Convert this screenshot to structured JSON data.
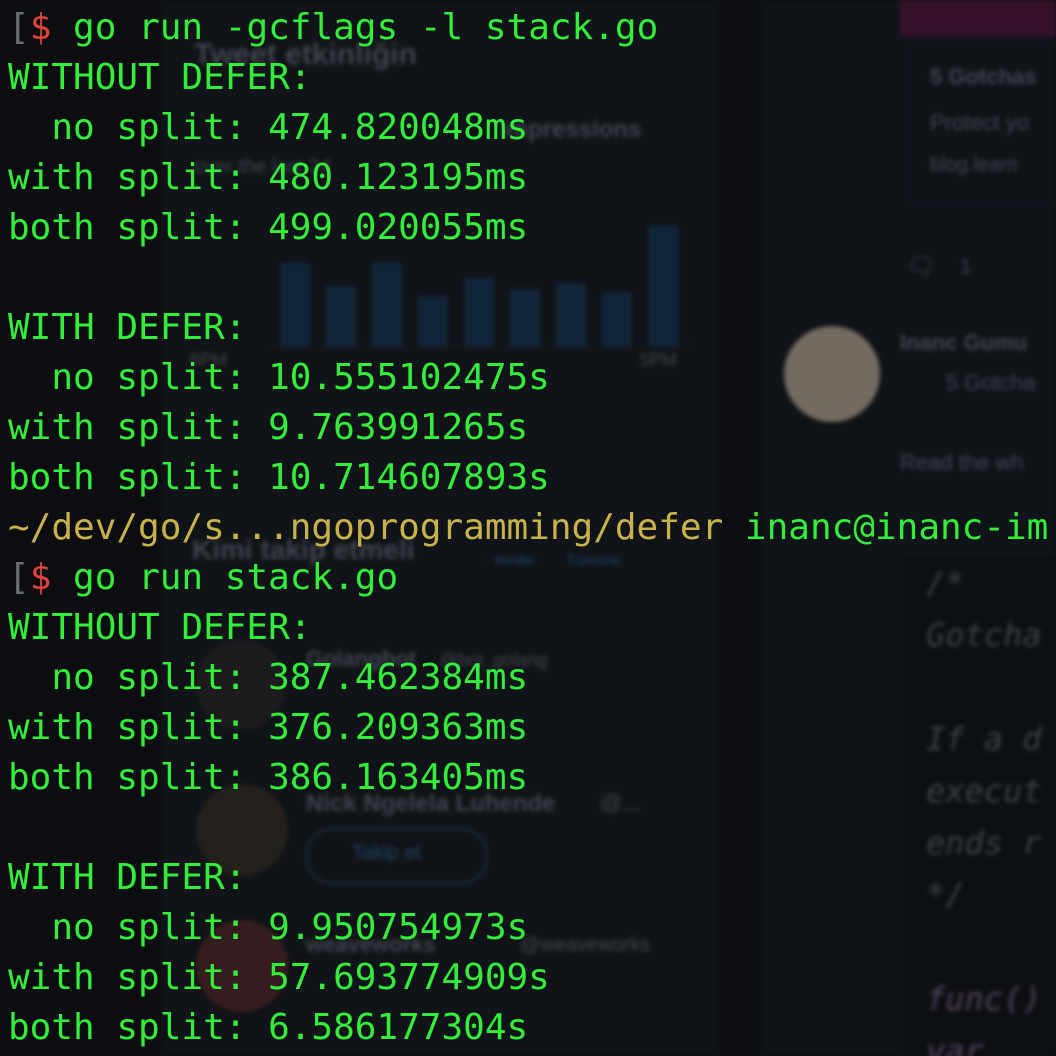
{
  "background": {
    "tweet_heading": "Tweet etkinliğin",
    "impressions_label": "Impressions",
    "over_label": "over the last 24",
    "chart_start_label": "6PM",
    "chart_end_label": "5PM",
    "chart_bars": [
      0.55,
      0.4,
      0.55,
      0.33,
      0.45,
      0.38,
      0.42,
      0.35,
      0.8
    ],
    "who_to_follow": "Kimi takip etmeli",
    "refresh": "· Yenile ·",
    "all": "Tümünü",
    "account1_name": "Golangbot",
    "account1_handle": "@bot_golang",
    "account2_name": "Nick Ngelela Luhende",
    "account2_handle": "@...",
    "follow_button": "Takip et",
    "account3_name": "weaveworks",
    "account3_handle": "@weaveworks",
    "card_title": "5 Gotchas",
    "card_line": "Protect yo",
    "card_url": "blog.learn",
    "reply_count": "1",
    "author_name": "Inanc Gumu",
    "author_sub": "5 Gotcha",
    "read_the": "Read the wh",
    "code_lines": [
      "/*",
      "Gotcha",
      "",
      "If a d",
      "execut",
      "ends r",
      "*/",
      "",
      "func()",
      "var"
    ],
    "colors": {
      "pink_accent": "#5a1740",
      "chart_blue": "#173a5e"
    }
  },
  "terminal": {
    "colors": {
      "output_green": "#33ee3b",
      "dollar_red": "#e0443e",
      "path_yellow": "#c8b24b"
    },
    "prompt_bracket": "[",
    "prompt_symbol": "$",
    "command1": " go run -gcflags -l stack.go",
    "run1": {
      "without_defer_header": "WITHOUT DEFER:",
      "without_no_split": "  no split: 474.820048ms",
      "without_with_split": "with split: 480.123195ms",
      "without_both_split": "both split: 499.020055ms",
      "with_defer_header": "WITH DEFER:",
      "with_no_split": "  no split: 10.555102475s",
      "with_with_split": "with split: 9.763991265s",
      "with_both_split": "both split: 10.714607893s"
    },
    "cwd_path": "~/dev/go/s...ngoprogramming/defer",
    "cwd_host": " inanc@inanc-im",
    "command2": " go run stack.go",
    "run2": {
      "without_defer_header": "WITHOUT DEFER:",
      "without_no_split": "  no split: 387.462384ms",
      "without_with_split": "with split: 376.209363ms",
      "without_both_split": "both split: 386.163405ms",
      "with_defer_header": "WITH DEFER:",
      "with_no_split": "  no split: 9.950754973s",
      "with_with_split": "with split: 57.693774909s",
      "with_both_split": "both split: 6.586177304s"
    }
  }
}
